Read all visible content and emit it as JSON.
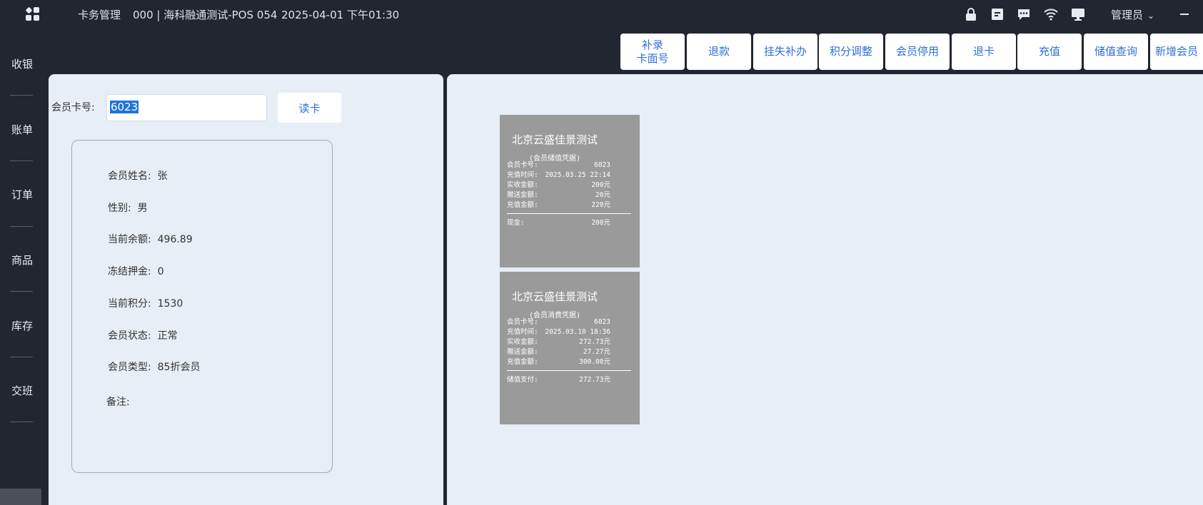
{
  "header": {
    "title": "卡务管理",
    "store": "000 | 海科融通测试-POS 054",
    "datetime": "2025-04-01 下午01:30",
    "user": "管理员",
    "icons": [
      "lock-icon",
      "archive-icon",
      "chat-icon",
      "wifi-icon",
      "monitor-icon"
    ]
  },
  "sidebar": {
    "items": [
      {
        "label": "收银"
      },
      {
        "label": "账单"
      },
      {
        "label": "订单"
      },
      {
        "label": "商品"
      },
      {
        "label": "库存"
      },
      {
        "label": "交班"
      }
    ]
  },
  "toolbar": {
    "buttons": [
      {
        "label": "补录\n卡面号"
      },
      {
        "label": "退款"
      },
      {
        "label": "挂失补办"
      },
      {
        "label": "积分调整"
      },
      {
        "label": "会员停用"
      },
      {
        "label": "退卡"
      },
      {
        "label": "充值"
      },
      {
        "label": "储值查询"
      },
      {
        "label": "新增会员"
      }
    ]
  },
  "member": {
    "card_label": "会员卡号:",
    "card_value": "6023",
    "read_button": "读卡",
    "fields": [
      {
        "label": "会员姓名:",
        "value": "张"
      },
      {
        "label": "性别:",
        "value": "男"
      },
      {
        "label": "当前余额:",
        "value": "496.89"
      },
      {
        "label": "冻结押金:",
        "value": "0"
      },
      {
        "label": "当前积分:",
        "value": "1530"
      },
      {
        "label": "会员状态:",
        "value": "正常"
      },
      {
        "label": "会员类型:",
        "value": "85折会员"
      },
      {
        "label": "备注:",
        "value": ""
      }
    ]
  },
  "receipts": [
    {
      "title": "北京云盛佳景测试",
      "subtitle": "(会员储值凭据)",
      "lines": [
        {
          "k": "会员卡号:",
          "v": "6023"
        },
        {
          "k": "充值时间:",
          "v": "2025.03.25 22:14"
        },
        {
          "k": "实收金额:",
          "v": "200元"
        },
        {
          "k": "赠送金额:",
          "v": "20元"
        },
        {
          "k": "充值金额:",
          "v": "220元"
        }
      ],
      "payment": {
        "k": "现金:",
        "v": "200元"
      }
    },
    {
      "title": "北京云盛佳景测试",
      "subtitle": "(会员消费凭据)",
      "lines": [
        {
          "k": "会员卡号:",
          "v": "6023"
        },
        {
          "k": "充值时间:",
          "v": "2025.03.10 18:36"
        },
        {
          "k": "实收金额:",
          "v": "272.73元"
        },
        {
          "k": "赠送金额:",
          "v": "27.27元"
        },
        {
          "k": "充值金额:",
          "v": "300.00元"
        }
      ],
      "payment": {
        "k": "储值支付:",
        "v": "272.73元"
      }
    }
  ]
}
